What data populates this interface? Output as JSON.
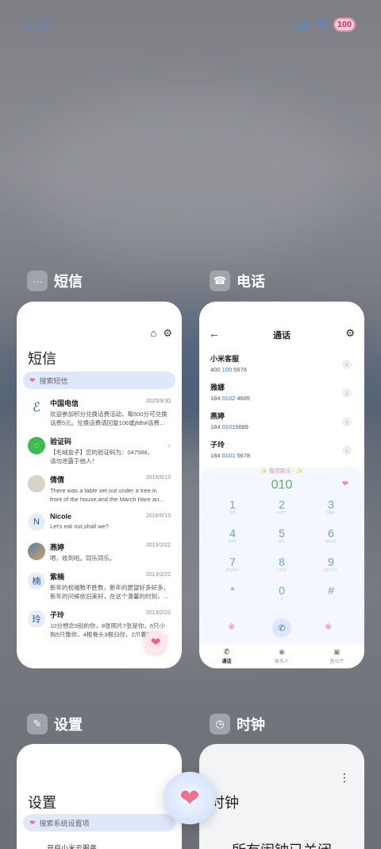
{
  "status_bar": {
    "time": "6:16",
    "battery": "100"
  },
  "recents": [
    {
      "app_name": "短信",
      "icon": "message-bubble-icon"
    },
    {
      "app_name": "电话",
      "icon": "phone-icon"
    },
    {
      "app_name": "设置",
      "icon": "settings-wrench-icon"
    },
    {
      "app_name": "时钟",
      "icon": "clock-icon"
    }
  ],
  "messages_card": {
    "title": "短信",
    "search_placeholder": "搜索短信",
    "items": [
      {
        "name": "中国电信",
        "date": "2025/9/30",
        "line1": "欢迎参加积分兑换话费活动，每500分可兑换",
        "line2": "话费5元。兑换话费请回复106或jfdh#话费..."
      },
      {
        "name": "验证码",
        "date": "",
        "line1": "【毛绒盒子】您的验证码为：047588，",
        "line2": "请勿泄露于他人！"
      },
      {
        "name": "倩倩",
        "date": "2016/6/13",
        "line1": "There was a table set out under a tree in",
        "line2": "front of the house,and the March Hare an..."
      },
      {
        "name": "Nicole",
        "date": "2016/6/13",
        "line1": "Let's eat out,shall we?",
        "line2": ""
      },
      {
        "name": "燕婷",
        "date": "2013/2/22",
        "line1": "嗯，收到啦。同乐同乐。",
        "line2": ""
      },
      {
        "name": "紫楠",
        "date": "2013/2/22",
        "line1": "新年的祝福数不胜数，新年的愿望好多好多，",
        "line2": "新年的问候依旧美好，在这个温馨的时刻，..."
      },
      {
        "name": "子玲",
        "date": "2013/2/22",
        "line1": "10分想念9别的你，8张照片7张是你，6只小",
        "line2": "狗5只像你，4根骨头3根归你，2爪着地1定..."
      }
    ],
    "avatars": {
      "Nicole": "N",
      "紫楠": "楠",
      "子玲": "玲"
    }
  },
  "phone_card": {
    "title": "通话",
    "contacts": [
      {
        "name": "小米客服",
        "pre": "400 ",
        "hl": "100",
        "post": " 5678"
      },
      {
        "name": "雅娜",
        "pre": "184 ",
        "hl": "0102",
        "post": " 4685"
      },
      {
        "name": "燕婷",
        "pre": "184 ",
        "hl": "0101",
        "post": "5689"
      },
      {
        "name": "子玲",
        "pre": "184 ",
        "hl": "0101",
        "post": " 5678"
      }
    ],
    "banner": "✨ 春然新乐 ·  ✨",
    "dialed_number": "010",
    "keys": [
      {
        "d": "1",
        "l": "QQ"
      },
      {
        "d": "2",
        "l": "ABC"
      },
      {
        "d": "3",
        "l": "DEF"
      },
      {
        "d": "4",
        "l": "GHI"
      },
      {
        "d": "5",
        "l": "JKL"
      },
      {
        "d": "6",
        "l": "MNO"
      },
      {
        "d": "7",
        "l": "PQRS"
      },
      {
        "d": "8",
        "l": "TUV"
      },
      {
        "d": "9",
        "l": "WXYZ"
      },
      {
        "d": "*",
        "l": ""
      },
      {
        "d": "0",
        "l": "+"
      },
      {
        "d": "#",
        "l": ""
      }
    ],
    "tabs": [
      {
        "label": "通话",
        "icon": "phone-icon",
        "active": true
      },
      {
        "label": "联系人",
        "icon": "contacts-icon",
        "active": false
      },
      {
        "label": "营业厅",
        "icon": "store-icon",
        "active": false
      }
    ]
  },
  "settings_card": {
    "title": "设置",
    "search_placeholder": "搜索系统设置项",
    "first_row": "开启小米云服务"
  },
  "clock_card": {
    "title": "时钟",
    "status": "所有闹钟已关闭"
  }
}
